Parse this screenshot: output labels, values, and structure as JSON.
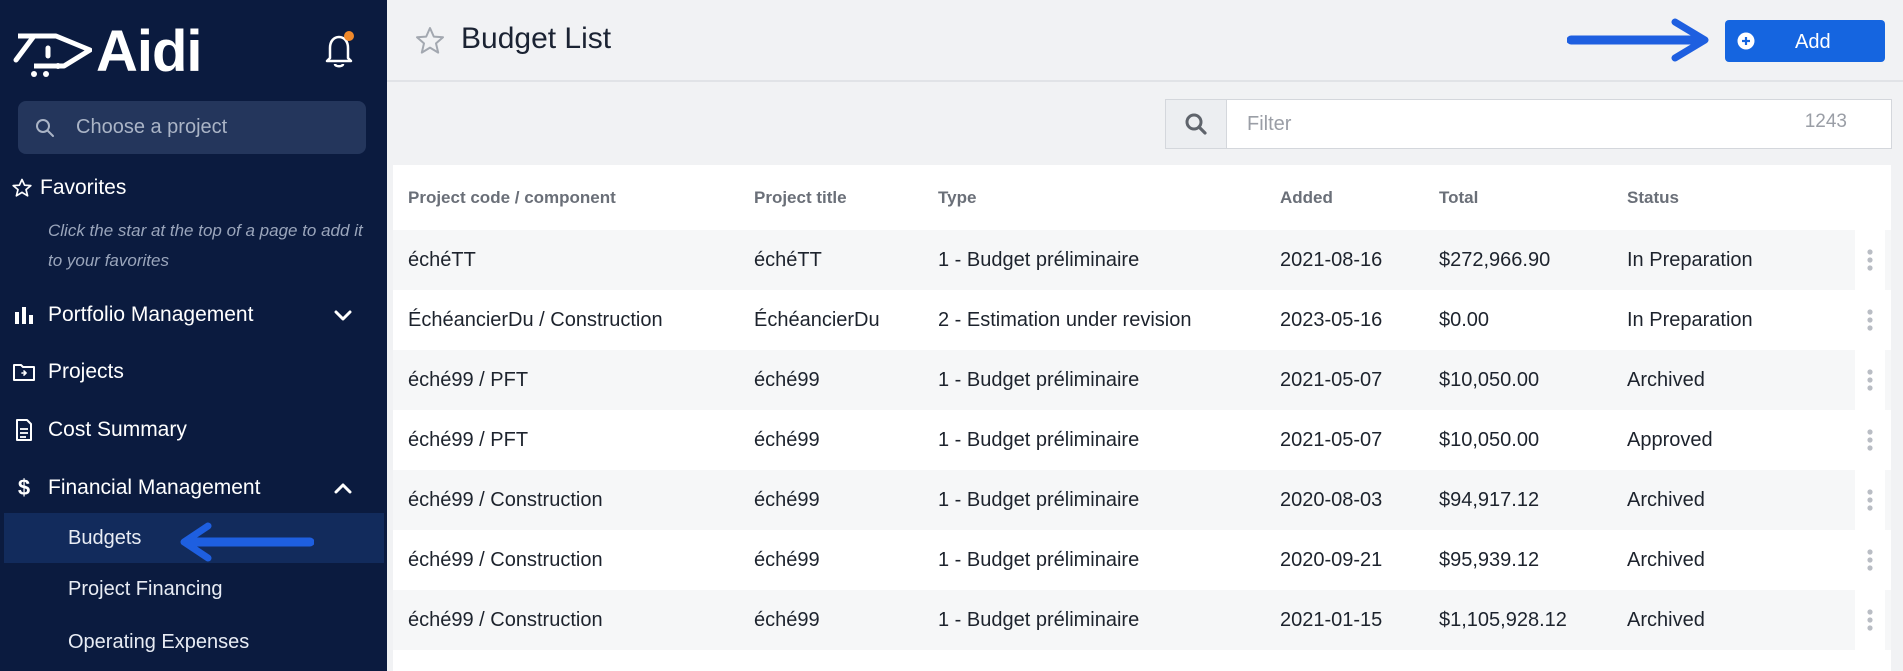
{
  "app": {
    "name": "Aidi"
  },
  "sidebar": {
    "search_placeholder": "Choose a project",
    "favorites": {
      "title": "Favorites",
      "hint": "Click the star at the top of a page to add it to your favorites"
    },
    "items": [
      {
        "label": "Portfolio Management",
        "icon": "bar-chart-icon",
        "expanded": false
      },
      {
        "label": "Projects",
        "icon": "folder-icon"
      },
      {
        "label": "Cost Summary",
        "icon": "document-icon"
      },
      {
        "label": "Financial Management",
        "icon": "dollar-icon",
        "expanded": true
      }
    ],
    "subitems": [
      {
        "label": "Budgets",
        "active": true
      },
      {
        "label": "Project Financing",
        "active": false
      },
      {
        "label": "Operating Expenses",
        "active": false
      }
    ]
  },
  "header": {
    "title": "Budget List",
    "add_label": "Add"
  },
  "filter": {
    "placeholder": "Filter",
    "count": "1243"
  },
  "table": {
    "columns": [
      "Project code / component",
      "Project title",
      "Type",
      "Added",
      "Total",
      "Status"
    ],
    "rows": [
      [
        "échéTT",
        "échéTT",
        "1 - Budget préliminaire",
        "2021-08-16",
        "$272,966.90",
        "In Preparation"
      ],
      [
        "ÉchéancierDu / Construction",
        "ÉchéancierDu",
        "2 - Estimation under revision",
        "2023-05-16",
        "$0.00",
        "In Preparation"
      ],
      [
        "éché99 / PFT",
        "éché99",
        "1 - Budget préliminaire",
        "2021-05-07",
        "$10,050.00",
        "Archived"
      ],
      [
        "éché99 / PFT",
        "éché99",
        "1 - Budget préliminaire",
        "2021-05-07",
        "$10,050.00",
        "Approved"
      ],
      [
        "éché99 / Construction",
        "éché99",
        "1 - Budget préliminaire",
        "2020-08-03",
        "$94,917.12",
        "Archived"
      ],
      [
        "éché99 / Construction",
        "éché99",
        "1 - Budget préliminaire",
        "2020-09-21",
        "$95,939.12",
        "Archived"
      ],
      [
        "éché99 / Construction",
        "éché99",
        "1 - Budget préliminaire",
        "2021-01-15",
        "$1,105,928.12",
        "Archived"
      ]
    ]
  },
  "colors": {
    "sidebar_bg": "#0b1b3f",
    "accent": "#1565e0",
    "notification_dot": "#f0892b",
    "annotation_arrow": "#1e5fe0"
  }
}
